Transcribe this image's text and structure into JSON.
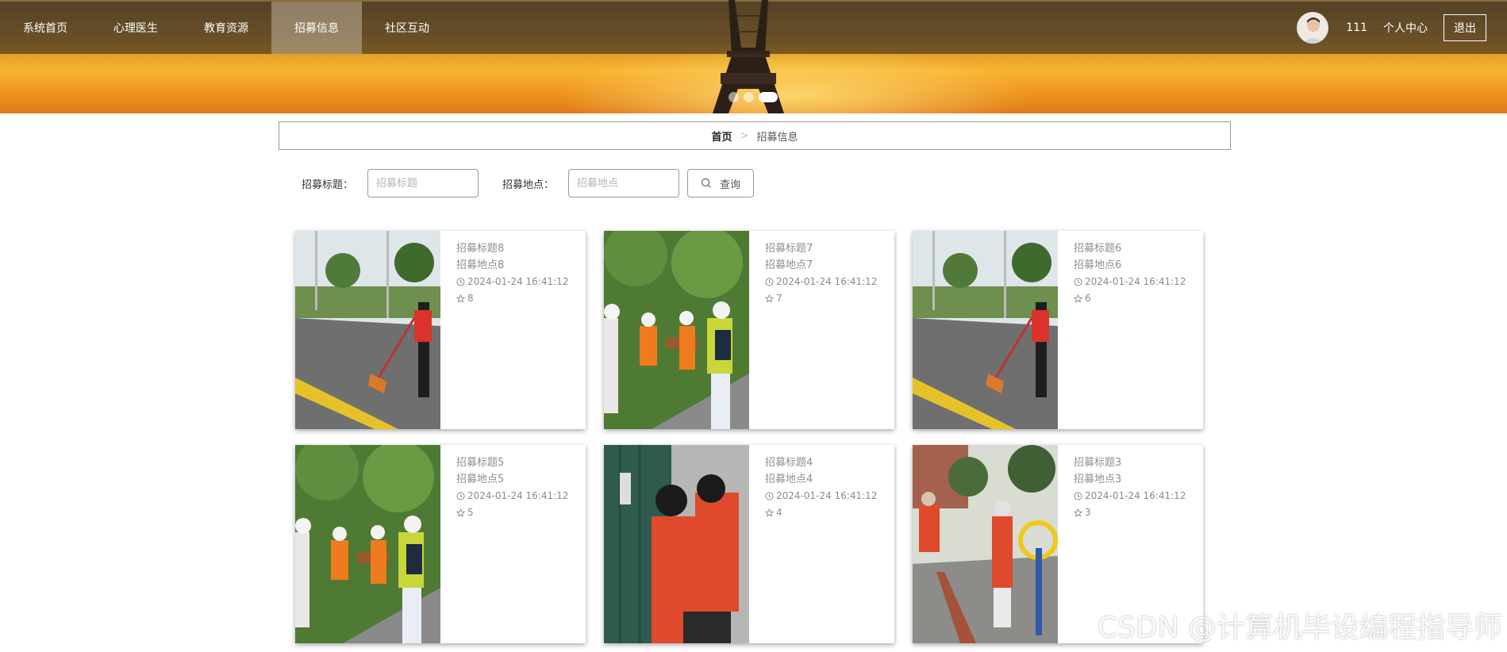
{
  "nav": {
    "items": [
      {
        "label": "系统首页"
      },
      {
        "label": "心理医生"
      },
      {
        "label": "教育资源"
      },
      {
        "label": "招募信息",
        "active": true
      },
      {
        "label": "社区互动"
      }
    ],
    "user_name": "111",
    "personal_center": "个人中心",
    "logout": "退出"
  },
  "carousel": {
    "dots": 3,
    "active_index": 2
  },
  "breadcrumb": {
    "home": "首页",
    "separator": ">",
    "current": "招募信息"
  },
  "search": {
    "title_label": "招募标题：",
    "title_placeholder": "招募标题",
    "location_label": "招募地点：",
    "location_placeholder": "招募地点",
    "button_label": "查询"
  },
  "cards": [
    {
      "title": "招募标题8",
      "location": "招募地点8",
      "time": "2024-01-24 16:41:12",
      "stars": "8",
      "photo": "street-sweeping"
    },
    {
      "title": "招募标题7",
      "location": "招募地点7",
      "time": "2024-01-24 16:41:12",
      "stars": "7",
      "photo": "kids-cleanup"
    },
    {
      "title": "招募标题6",
      "location": "招募地点6",
      "time": "2024-01-24 16:41:12",
      "stars": "6",
      "photo": "street-sweeping"
    },
    {
      "title": "招募标题5",
      "location": "招募地点5",
      "time": "2024-01-24 16:41:12",
      "stars": "5",
      "photo": "kids-cleanup"
    },
    {
      "title": "招募标题4",
      "location": "招募地点4",
      "time": "2024-01-24 16:41:12",
      "stars": "4",
      "photo": "door-cleaning"
    },
    {
      "title": "招募标题3",
      "location": "招募地点3",
      "time": "2024-01-24 16:41:12",
      "stars": "3",
      "photo": "park-cleaning"
    }
  ],
  "watermark": "CSDN @计算机毕设编程指导师",
  "colors": {
    "nav_overlay": "#28201680",
    "accent_orange": "#f7b531"
  }
}
